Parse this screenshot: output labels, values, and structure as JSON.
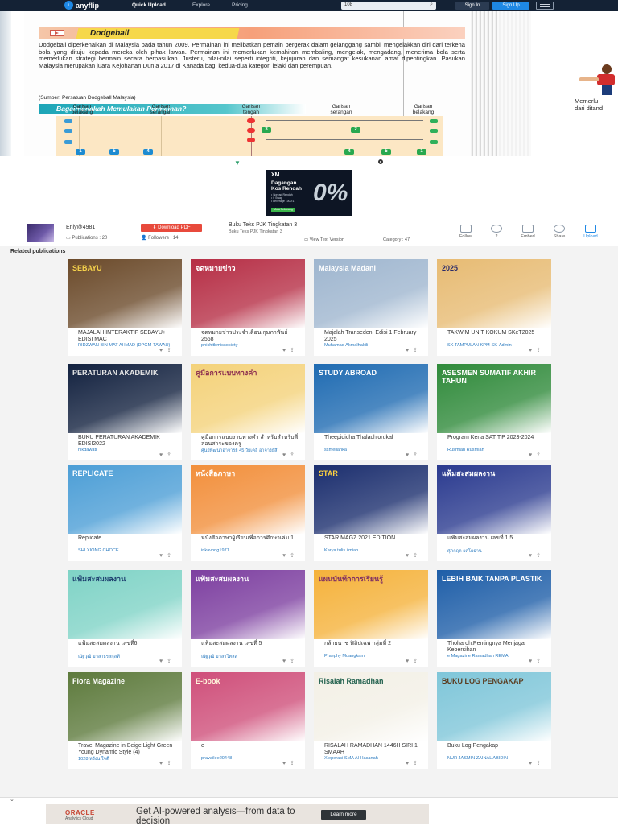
{
  "nav": {
    "brand": "anyflip",
    "links": [
      "Quick Upload",
      "Explore",
      "Pricing"
    ],
    "search_value": "108",
    "signin": "Sign In",
    "signup": "Sign Up"
  },
  "book_page": {
    "section_title": "Dodgeball",
    "body": "Dodgeball diperkenalkan di Malaysia pada tahun 2009. Permainan ini melibatkan pemain bergerak dalam gelanggang sambil mengelakkan diri dari terkena bola yang dituju kepada mereka oleh pihak lawan. Permainan ini memerlukan kemahiran membaling, mengelak, mengadang, menerima bola serta memerlukan strategi bermain secara berpasukan. Justeru, nilai-nilai seperti integriti, kejujuran dan semangat kesukanan amat dipentingkan. Pasukan Malaysia merupakan juara Kejohanan Dunia 2017 di Kanada bagi kedua-dua kategori lelaki dan perempuan.",
    "source": "(Sumber: Persatuan Dodgeball Malaysia)",
    "how_title": "Bagaimanakah Memulakan Permainan?",
    "court_labels": [
      "Garisan belakang",
      "Garisan serangan",
      "Garisan tengah",
      "Garisan serangan",
      "Garisan belakang"
    ],
    "right_text_1": "Memerlu",
    "right_text_2": "dari ditand"
  },
  "ad_top": {
    "brand": "XM",
    "headline_1": "Dagangan",
    "headline_2": "Kos Rendah",
    "lines": [
      "• Spread Rendah",
      "• 0 Swap",
      "• Leverage 1000:1"
    ],
    "button": "Mula Sekarang",
    "big": "0%"
  },
  "info": {
    "author": "Eniy@4981",
    "download": "Download PDF",
    "publications": "Publications : 20",
    "followers": "Followers : 14",
    "doc_title": "Buku Teks PJK Tingkatan 3",
    "doc_sub": "Buku Teks PJK Tingkatan 3",
    "view_text": "View Text Version",
    "category": "Category : 47",
    "actions": [
      {
        "label": "Follow"
      },
      {
        "label": "2"
      },
      {
        "label": "Embed"
      },
      {
        "label": "Share"
      },
      {
        "label": "Upload"
      }
    ]
  },
  "related": {
    "heading": "Related publications",
    "cards": [
      {
        "title": "MAJALAH INTERAKTIF SEBAYU+ EDISI MAC",
        "by": "RIDZWAN BIN MAT AHMAD (DPGM-TAWAU)",
        "cover": "SEBAYU",
        "bg": "#6b4a2a",
        "fg": "#f5d14b"
      },
      {
        "title": "จดหมายข่าวประจำเดือน กุมภาพันธ์ 2568",
        "by": "phichitbmissociety",
        "cover": "จดหมายข่าว",
        "bg": "#b62e45",
        "fg": "#ffffff"
      },
      {
        "title": "Majalah Transeden. Edisi 1 February 2025",
        "by": "Muhamad Akmalhakili",
        "cover": "Malaysia Madani",
        "bg": "#9fb6cf",
        "fg": "#ffffff"
      },
      {
        "title": "TAKWIM UNIT KOKUM SKeT2025",
        "by": "SK TAMPULAN KPM-SK-Admin",
        "cover": "2025",
        "bg": "#e7bb73",
        "fg": "#2b2b6a"
      },
      {
        "title": "BUKU PERATURAN AKADEMIK EDISI2022",
        "by": "nikdawati",
        "cover": "PERATURAN AKADEMIK",
        "bg": "#12213f",
        "fg": "#e6e6e6"
      },
      {
        "title": "คู่มือการแบบงานทางคำ สำหรับสำหรับพี่สอนสาระของครู",
        "by": "ศูนย์พัฒนาอาจารย์ 45 วัยเคลี่ อาจารย์สิ",
        "cover": "คู่มือการแบบทางคำ",
        "bg": "#f4d27a",
        "fg": "#8b2c4f"
      },
      {
        "title": "Theepidicha Thalachiorukal",
        "by": "ssmelianka",
        "cover": "STUDY ABROAD",
        "bg": "#1f6bb2",
        "fg": "#ffffff"
      },
      {
        "title": "Program Kerja SAT T.P 2023-2024",
        "by": "Rusmiah Rusmiah",
        "cover": "ASESMEN SUMATIF AKHIR TAHUN",
        "bg": "#2f8a3a",
        "fg": "#ffffff"
      },
      {
        "title": "Replicate",
        "by": "SHI XIONG CHOCE",
        "cover": "REPLICATE",
        "bg": "#4c9ed6",
        "fg": "#ffffff"
      },
      {
        "title": "หนังสือภาษาผู้เรียนเพื่อการศึกษาเล่ม 1",
        "by": "inkavong1971",
        "cover": "หนังสือภาษา",
        "bg": "#f28f3b",
        "fg": "#ffffff"
      },
      {
        "title": "STAR MAGZ 2021 EDITION",
        "by": "Karya tulis ilmiah",
        "cover": "STAR",
        "bg": "#1b2e6e",
        "fg": "#ffd23f"
      },
      {
        "title": "แฟ้มสะสมผลงาน เลขที่ 1 5",
        "by": "ศุภกฤต ยศโยธาน",
        "cover": "แฟ้มสะสมผลงาน",
        "bg": "#2a3a8f",
        "fg": "#ffffff"
      },
      {
        "title": "แฟ้มสะสมผลงาน เลขที่6",
        "by": "ณัฐวุฒิ มาลาธรสกุลที",
        "cover": "แฟ้มสะสมผลงาน",
        "bg": "#7fd3c6",
        "fg": "#1d3e6e"
      },
      {
        "title": "แฟ้มสะสมผลงาน เลขที่ 5",
        "by": "ณัฐวุฒิ มาลาโทลส",
        "cover": "แฟ้มสะสมผลงาน",
        "bg": "#7d3fa0",
        "fg": "#ffffff"
      },
      {
        "title": "กล้ายนาช ฟิลิปเฉพ กลุ่มที่ 2",
        "by": "Praephy Muangkam",
        "cover": "แผนบันทึกการเรียนรู้",
        "bg": "#f5b23b",
        "fg": "#7d2c63"
      },
      {
        "title": "Thoharoh:Pentingnya Menjaga Kebersihan",
        "by": "e Magazine Ramadhan REMA",
        "cover": "LEBIH BAIK TANPA PLASTIK",
        "bg": "#1e5ea8",
        "fg": "#ffffff"
      },
      {
        "title": "Travel Magazine in Beige Light Green Young Dynamic Style (4)",
        "by": "1028 หวังน ใจดี",
        "cover": "Flora Magazine",
        "bg": "#5d7a3c",
        "fg": "#ffffff"
      },
      {
        "title": "e",
        "by": "pravailee20448",
        "cover": "E-book",
        "bg": "#cf4f7a",
        "fg": "#fff6dc"
      },
      {
        "title": "RISALAH RAMADHAN 1446H SIRI 1 SMAAH",
        "by": "Xieperasi SMA Al Hasanah",
        "cover": "Risalah Ramadhan",
        "bg": "#f3f0e6",
        "fg": "#1f5f4c"
      },
      {
        "title": "Buku Log Pengakap",
        "by": "NUR JASMIN ZAINAL ABIDIN",
        "cover": "BUKU LOG PENGAKAP",
        "bg": "#7fc6d9",
        "fg": "#5a3b1e"
      }
    ]
  },
  "ad_bottom": {
    "brand": "ORACLE",
    "brand_sub": "Analytics Cloud",
    "text": "Get AI-powered analysis—from data to decision",
    "button": "Learn more"
  }
}
